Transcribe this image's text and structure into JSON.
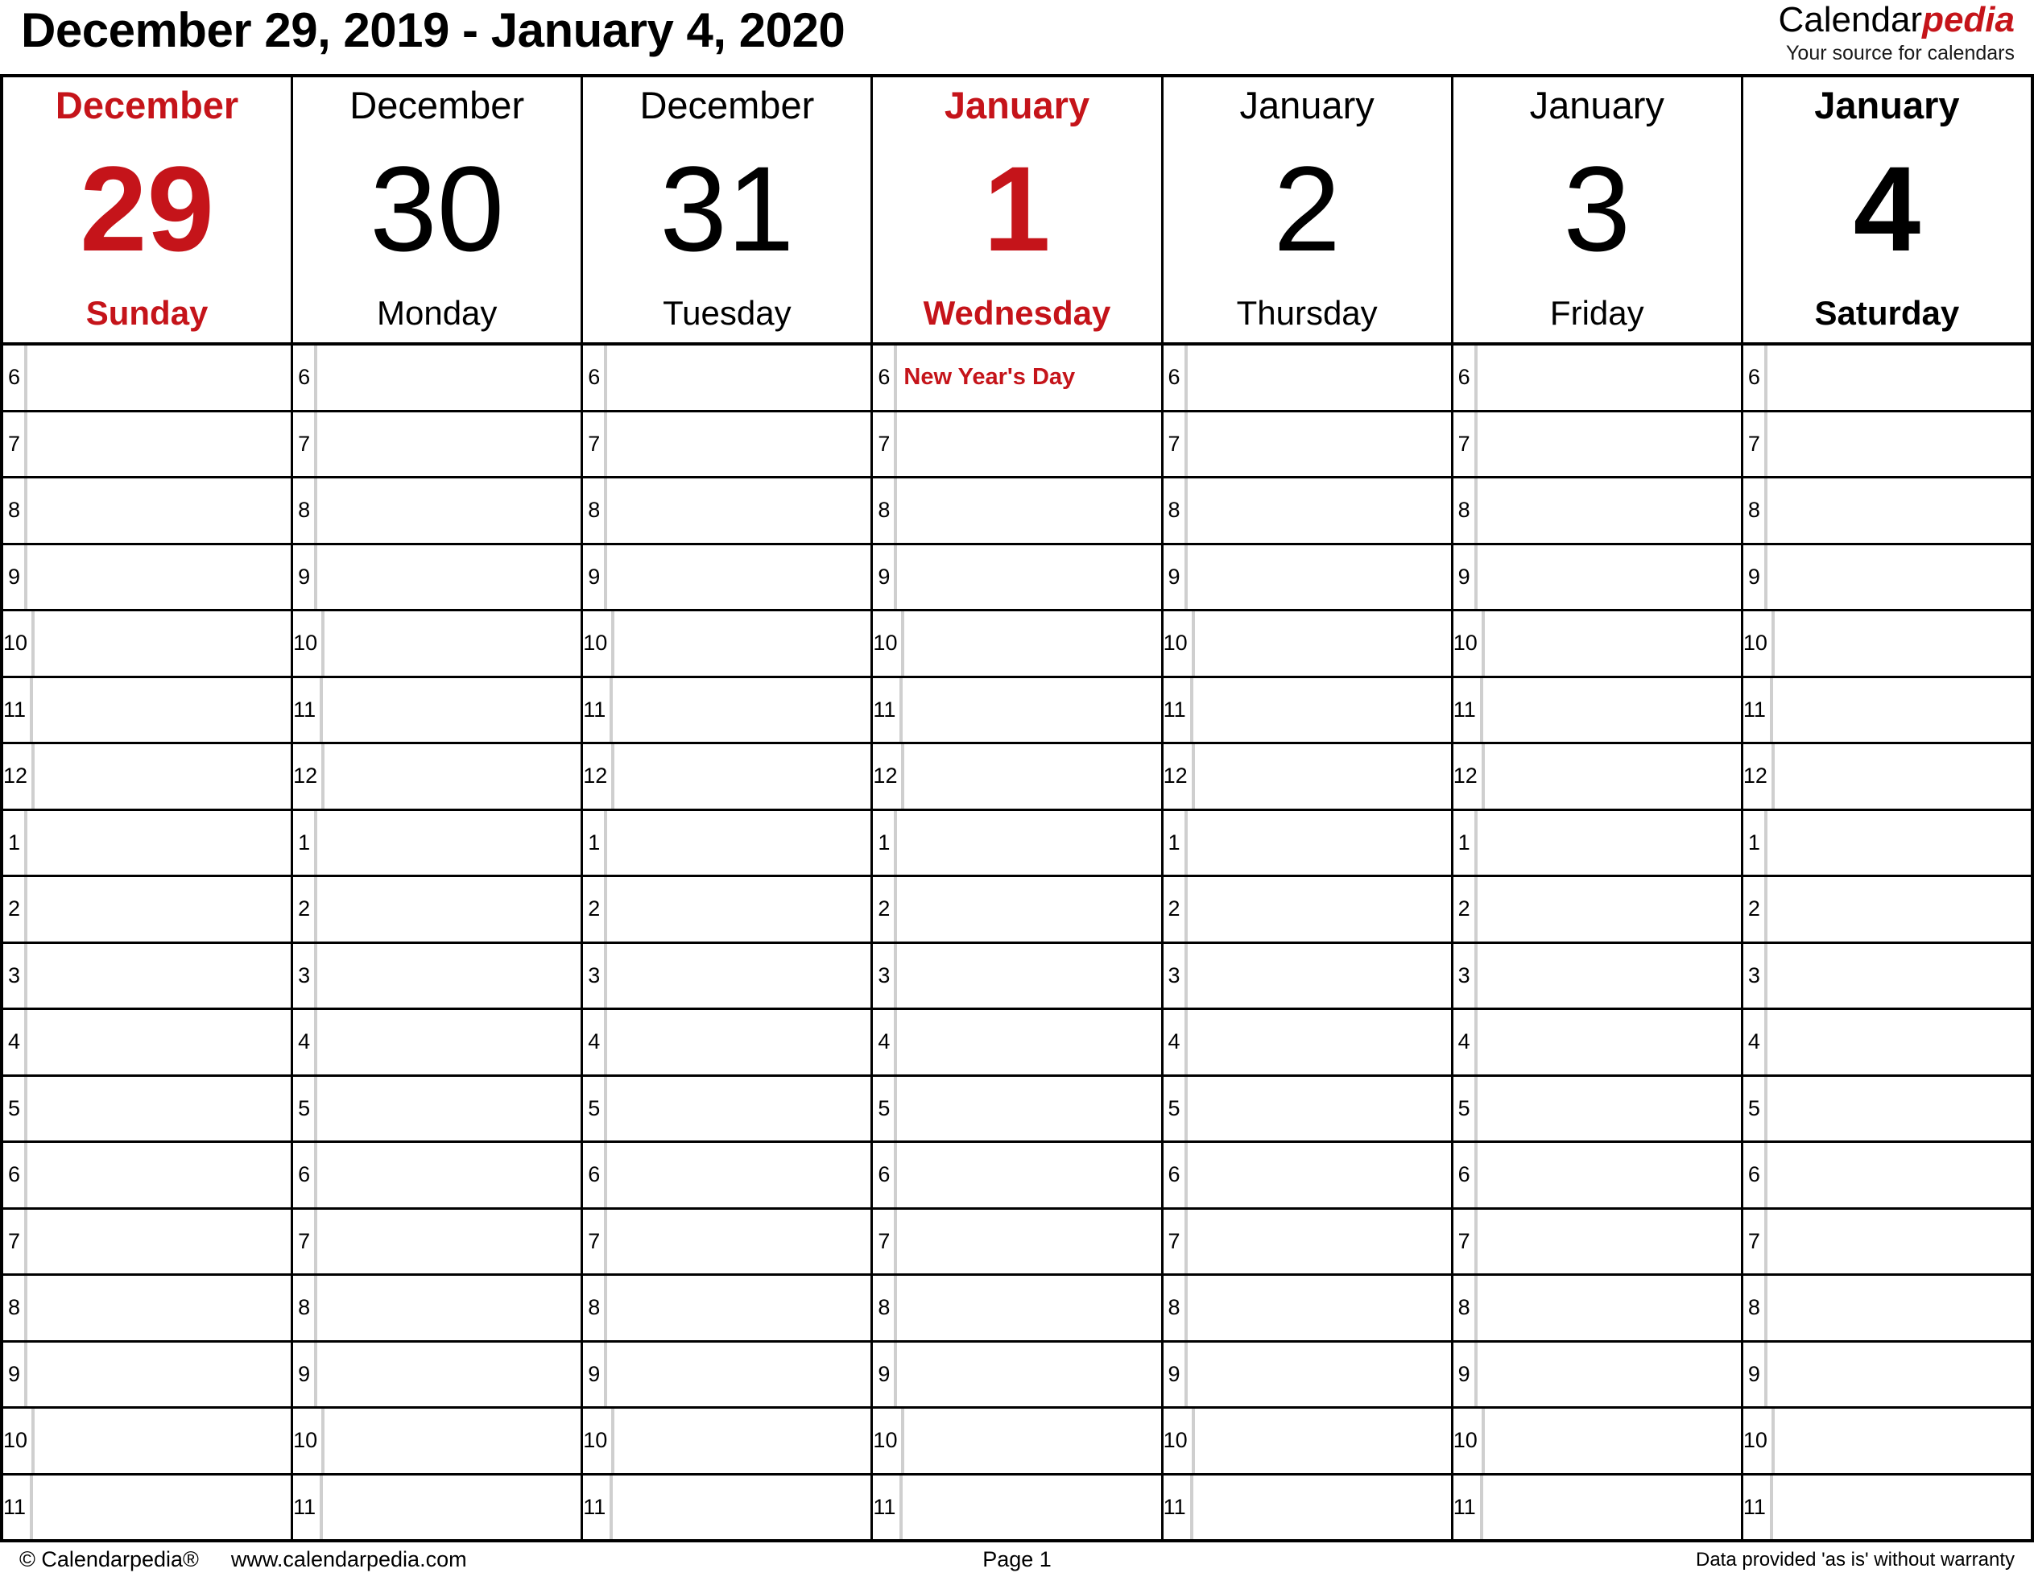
{
  "header": {
    "title": "December 29, 2019 - January 4, 2020",
    "brand_primary": "Calendar",
    "brand_accent": "pedia",
    "brand_tagline": "Your source for calendars"
  },
  "colors": {
    "accent_red": "#C5141A",
    "text_black": "#000000",
    "gutter_line": "#cfcfcf",
    "grid_line": "#000000"
  },
  "days": [
    {
      "month": "December",
      "number": "29",
      "weekday": "Sunday",
      "style": "weekend-red"
    },
    {
      "month": "December",
      "number": "30",
      "weekday": "Monday",
      "style": "weekday"
    },
    {
      "month": "December",
      "number": "31",
      "weekday": "Tuesday",
      "style": "weekday"
    },
    {
      "month": "January",
      "number": "1",
      "weekday": "Wednesday",
      "style": "holiday-red"
    },
    {
      "month": "January",
      "number": "2",
      "weekday": "Thursday",
      "style": "weekday"
    },
    {
      "month": "January",
      "number": "3",
      "weekday": "Friday",
      "style": "weekday"
    },
    {
      "month": "January",
      "number": "4",
      "weekday": "Saturday",
      "style": "weekend-bold"
    }
  ],
  "hours": [
    "6",
    "7",
    "8",
    "9",
    "10",
    "11",
    "12",
    "1",
    "2",
    "3",
    "4",
    "5",
    "6",
    "7",
    "8",
    "9",
    "10",
    "11"
  ],
  "events": [
    {
      "day_index": 3,
      "hour_index": 0,
      "label": "New Year's Day",
      "color": "#C5141A"
    }
  ],
  "footer": {
    "copyright": "© Calendarpedia®",
    "website": "www.calendarpedia.com",
    "page": "Page 1",
    "disclaimer": "Data provided 'as is' without warranty"
  }
}
